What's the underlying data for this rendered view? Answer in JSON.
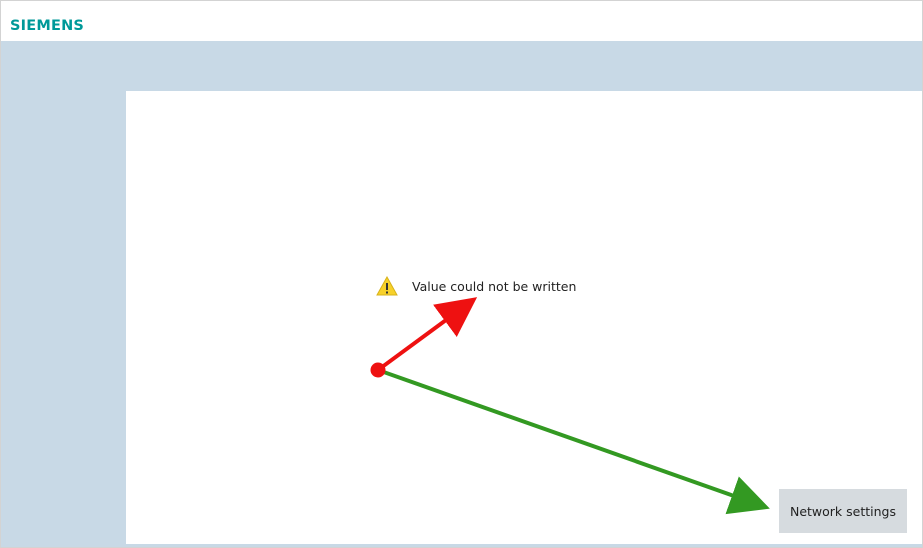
{
  "brand": {
    "logo_text": "SIEMENS",
    "color": "#009999"
  },
  "message": {
    "text": "Value could not be written",
    "icon": "warning-icon"
  },
  "buttons": {
    "network_settings": "Network settings"
  },
  "colors": {
    "band": "#c8d9e6",
    "panel": "#ffffff",
    "button_bg": "#d6dbdf",
    "annotation_red": "#ee1111",
    "annotation_green": "#339922"
  }
}
